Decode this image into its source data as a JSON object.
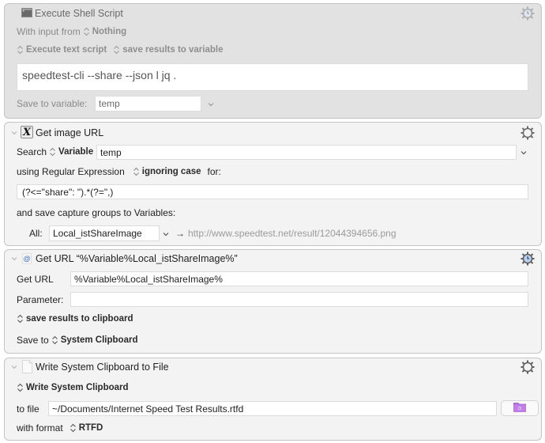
{
  "actions": [
    {
      "title": "Execute Shell Script",
      "icon": "terminal-icon",
      "enabled": false,
      "input_label": "With input from",
      "input_value": "Nothing",
      "execute_mode": "Execute text script",
      "result_mode": "save results to variable",
      "script": "speedtest-cli --share --json l jq .",
      "save_label": "Save to variable:",
      "save_variable": "temp"
    },
    {
      "title": "Get image URL",
      "icon": "regex-variable-icon",
      "enabled": true,
      "search_label": "Search",
      "search_source": "Variable",
      "search_value": "temp",
      "using_label": "using Regular Expression",
      "case_mode": "ignoring case",
      "for_label": "for:",
      "regex": "(?<=\"share\": \").*(?=\",)",
      "capture_label": "and save capture groups to Variables:",
      "all_label": "All:",
      "all_variable": "Local_istShareImage",
      "preview_arrow": "→",
      "preview_value": "http://www.speedtest.net/result/12044394656.png"
    },
    {
      "title": "Get URL “%Variable%Local_istShareImage%”",
      "icon": "url-at-icon",
      "enabled": true,
      "url_label": "Get URL",
      "url_value": "%Variable%Local_istShareImage%",
      "param_label": "Parameter:",
      "param_value": "",
      "result_mode": "save results to clipboard",
      "save_to_label": "Save to",
      "save_to_value": "System Clipboard"
    },
    {
      "title": "Write System Clipboard to File",
      "icon": "document-icon",
      "enabled": true,
      "write_mode": "Write System Clipboard",
      "file_label": "to file",
      "file_value": "~/Documents/Internet Speed Test Results.rtfd",
      "format_label": "with format",
      "format_value": "RTFD"
    }
  ],
  "colors": {
    "folder_accent": "#b46de0",
    "clock_gear_accent": "#6f9fd8"
  }
}
